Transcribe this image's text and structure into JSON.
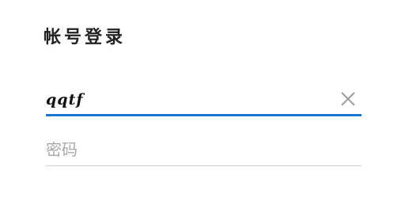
{
  "login": {
    "title": "帐号登录",
    "account": {
      "value": "qqtf",
      "clear_icon": "close-icon"
    },
    "password": {
      "value": "",
      "placeholder": "密码"
    }
  },
  "colors": {
    "accent": "#1a76d2",
    "divider": "#cfcfcf",
    "placeholder": "#a8a8a8",
    "clear_icon": "#9e9e9e"
  }
}
